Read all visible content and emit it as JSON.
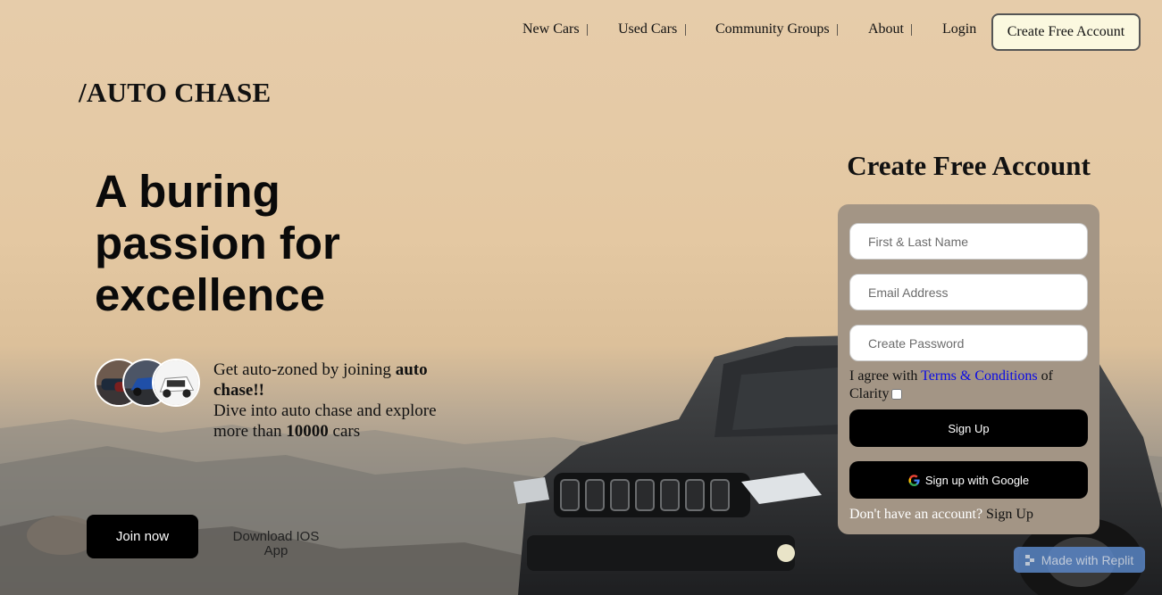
{
  "nav": {
    "links": [
      "New Cars",
      "Used Cars",
      "Community Groups",
      "About",
      "Login"
    ],
    "separator": "|",
    "cta_label": "Create Free Account"
  },
  "brand": {
    "logo": "/AUTO CHASE"
  },
  "hero": {
    "title_lines": [
      "A buring",
      "passion for",
      "excellence"
    ],
    "blurb": {
      "part1": "Get auto-zoned by joining ",
      "bold1": "auto chase!!",
      "line2": "Dive into auto chase and explore",
      "line3_prefix": "more than ",
      "bold2": "10000",
      "line3_suffix": " cars"
    },
    "join_label": "Join now",
    "ios_label": "Download IOS App"
  },
  "form": {
    "title": "Create Free Account",
    "name_placeholder": "First & Last Name",
    "email_placeholder": "Email Address",
    "password_placeholder": "Create Password",
    "agree_prefix": "I agree with ",
    "agree_link": "Terms & Conditions",
    "agree_suffix": " of Clarity",
    "signup_label": "Sign Up",
    "google_label": "Sign up with Google",
    "have_account": "Don't have an account?",
    "signup_link": " Sign Up"
  },
  "badge": {
    "label": "Made with Replit"
  },
  "colors": {
    "card": "#a39585",
    "cta_bg": "#fbf8df",
    "link": "#0a0ae6",
    "replit": "#5a86c6"
  },
  "icons": [
    "google-icon",
    "replit-icon"
  ]
}
